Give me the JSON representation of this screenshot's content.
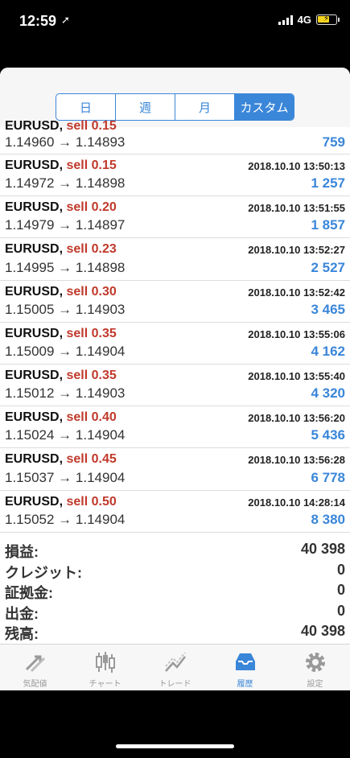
{
  "status": {
    "time": "12:59",
    "network": "4G"
  },
  "segments": [
    "日",
    "週",
    "月",
    "カスタム"
  ],
  "partial_row": {
    "symbol": "EURUSD,",
    "side": "sell 0.15",
    "price": "1.14960 → 1.14893",
    "profit": "759"
  },
  "trades": [
    {
      "symbol": "EURUSD,",
      "side": "sell 0.15",
      "time": "2018.10.10 13:50:13",
      "price": "1.14972 → 1.14898",
      "profit": "1 257"
    },
    {
      "symbol": "EURUSD,",
      "side": "sell 0.20",
      "time": "2018.10.10 13:51:55",
      "price": "1.14979 → 1.14897",
      "profit": "1 857"
    },
    {
      "symbol": "EURUSD,",
      "side": "sell 0.23",
      "time": "2018.10.10 13:52:27",
      "price": "1.14995 → 1.14898",
      "profit": "2 527"
    },
    {
      "symbol": "EURUSD,",
      "side": "sell 0.30",
      "time": "2018.10.10 13:52:42",
      "price": "1.15005 → 1.14903",
      "profit": "3 465"
    },
    {
      "symbol": "EURUSD,",
      "side": "sell 0.35",
      "time": "2018.10.10 13:55:06",
      "price": "1.15009 → 1.14904",
      "profit": "4 162"
    },
    {
      "symbol": "EURUSD,",
      "side": "sell 0.35",
      "time": "2018.10.10 13:55:40",
      "price": "1.15012 → 1.14903",
      "profit": "4 320"
    },
    {
      "symbol": "EURUSD,",
      "side": "sell 0.40",
      "time": "2018.10.10 13:56:20",
      "price": "1.15024 → 1.14904",
      "profit": "5 436"
    },
    {
      "symbol": "EURUSD,",
      "side": "sell 0.45",
      "time": "2018.10.10 13:56:28",
      "price": "1.15037 → 1.14904",
      "profit": "6 778"
    },
    {
      "symbol": "EURUSD,",
      "side": "sell 0.50",
      "time": "2018.10.10 14:28:14",
      "price": "1.15052 → 1.14904",
      "profit": "8 380"
    }
  ],
  "summary": [
    {
      "label": "損益:",
      "value": "40 398"
    },
    {
      "label": "クレジット:",
      "value": "0"
    },
    {
      "label": "証拠金:",
      "value": "0"
    },
    {
      "label": "出金:",
      "value": "0"
    },
    {
      "label": "残高:",
      "value": "40 398"
    }
  ],
  "tabs": [
    {
      "label": "気配値",
      "icon": "quotes-arrows-icon",
      "active": false
    },
    {
      "label": "チャート",
      "icon": "candlestick-chart-icon",
      "active": false
    },
    {
      "label": "トレード",
      "icon": "trade-chart-icon",
      "active": false
    },
    {
      "label": "履歴",
      "icon": "history-inbox-icon",
      "active": true
    },
    {
      "label": "設定",
      "icon": "gear-icon",
      "active": false
    }
  ],
  "colors": {
    "accent": "#3a86d9",
    "sell": "#c0392b"
  }
}
